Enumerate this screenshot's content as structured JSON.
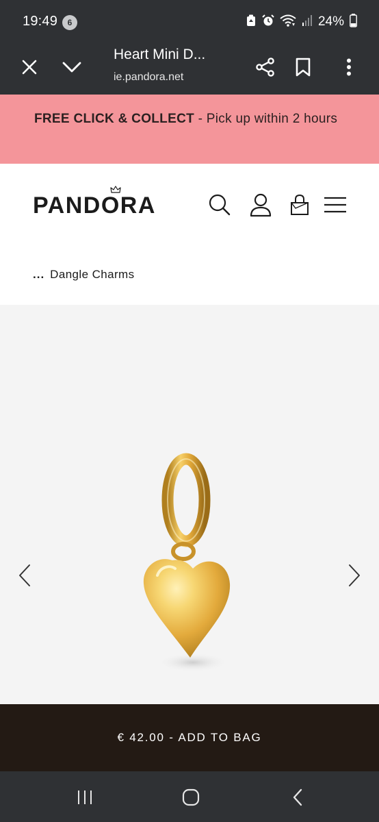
{
  "status_bar": {
    "time": "19:49",
    "notification_count": "6",
    "battery": "24%"
  },
  "browser": {
    "page_title": "Heart Mini D...",
    "url": "ie.pandora.net",
    "icons": [
      "close-icon",
      "chevron-down-icon",
      "share-icon",
      "bookmark-icon",
      "more-vert-icon"
    ]
  },
  "promo": {
    "bold": "FREE CLICK & COLLECT",
    "text": " - Pick up within 2 hours"
  },
  "header": {
    "logo": "PANDORA",
    "icons": [
      "search-icon",
      "account-icon",
      "shopping-bag-icon",
      "menu-icon"
    ]
  },
  "breadcrumb": {
    "dots": "...",
    "label": "Dangle Charms"
  },
  "gallery": {
    "prev_icon": "chevron-left-icon",
    "next_icon": "chevron-right-icon",
    "product": "gold-heart-dangle-charm"
  },
  "cta": {
    "label": "€ 42.00 - ADD TO BAG"
  },
  "colors": {
    "system_bar": "#2f3134",
    "promo_bg": "#f4959a",
    "cta_bg": "#231a14",
    "gallery_bg": "#f4f4f4",
    "gold": "#e2b245"
  }
}
